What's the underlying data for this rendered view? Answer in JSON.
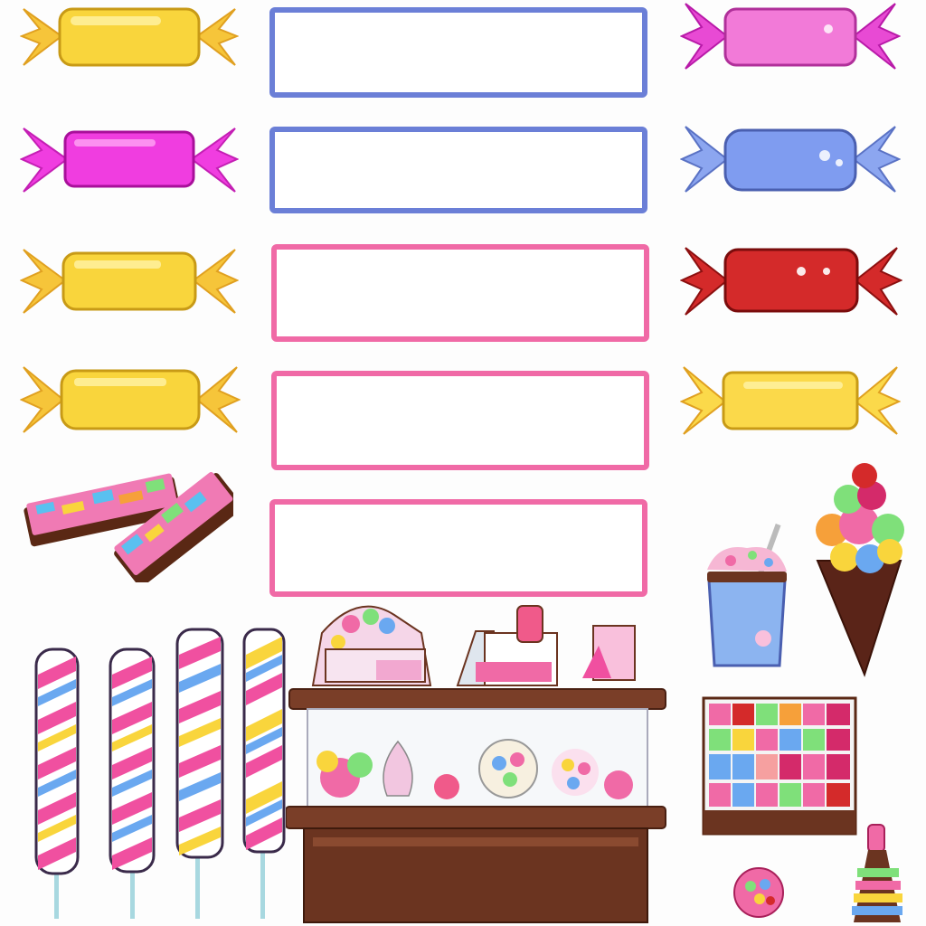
{
  "slots": [
    {
      "label": "",
      "color": "#6b7fd7"
    },
    {
      "label": "",
      "color": "#6b7fd7"
    },
    {
      "label": "",
      "color": "#f06aa6"
    },
    {
      "label": "",
      "color": "#f06aa6"
    },
    {
      "label": "",
      "color": "#f06aa6"
    }
  ],
  "candies_left": [
    {
      "name": "yellow-wrapped-candy",
      "color": "#f9d53c"
    },
    {
      "name": "magenta-wrapped-candy",
      "color": "#f03de0"
    },
    {
      "name": "yellow-wrapped-candy",
      "color": "#f9d53c"
    },
    {
      "name": "yellow-wrapped-candy",
      "color": "#f9d53c"
    }
  ],
  "candies_right": [
    {
      "name": "pink-wrapped-candy",
      "color": "#f27ad8"
    },
    {
      "name": "blue-wrapped-candy",
      "color": "#7f9cf0"
    },
    {
      "name": "red-wrapped-candy",
      "color": "#d42a2a"
    },
    {
      "name": "yellow-wrapped-candy",
      "color": "#fbd94a"
    }
  ],
  "colors": {
    "chocolate": "#6b3420",
    "counter_wood": "#7a3e28",
    "cone": "#5a2418"
  }
}
